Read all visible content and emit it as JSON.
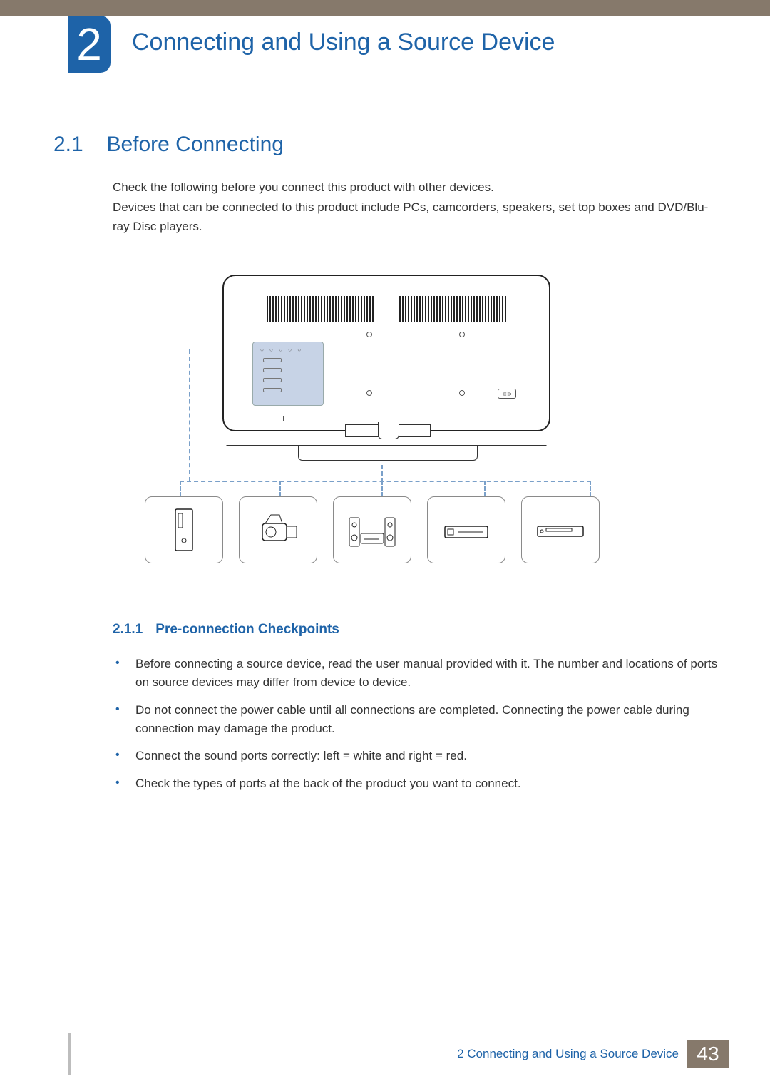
{
  "chapter": {
    "number": "2",
    "title": "Connecting and Using a Source Device"
  },
  "section": {
    "number": "2.1",
    "title": "Before Connecting"
  },
  "intro": {
    "p1": "Check the following before you connect this product with other devices.",
    "p2": "Devices that can be connected to this product include PCs, camcorders, speakers, set top boxes and DVD/Blu-ray Disc players."
  },
  "subsection": {
    "number": "2.1.1",
    "title": "Pre-connection Checkpoints"
  },
  "bullets": [
    "Before connecting a source device, read the user manual provided with it. The number and locations of ports on source devices may differ from device to device.",
    "Do not connect the power cable until all connections are completed. Connecting the power cable during connection may damage the product.",
    "Connect the sound ports correctly: left = white and right = red.",
    "Check the types of ports at the back of the product you want to connect."
  ],
  "devices": [
    "pc-tower",
    "camcorder",
    "speakers",
    "set-top-box",
    "dvd-player"
  ],
  "footer": {
    "label": "2 Connecting and Using a Source Device",
    "page": "43"
  }
}
